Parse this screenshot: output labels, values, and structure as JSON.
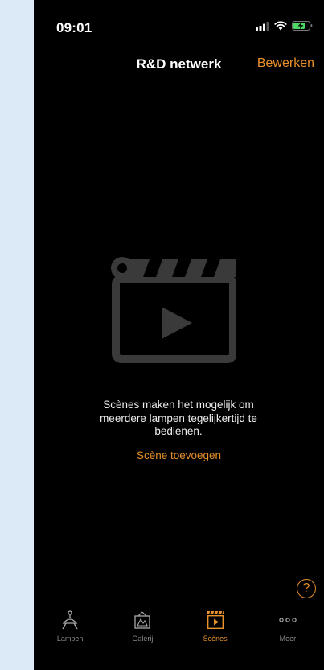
{
  "status_bar": {
    "time": "09:01"
  },
  "nav": {
    "title": "R&D netwerk",
    "edit_label": "Bewerken"
  },
  "empty_state": {
    "message": "Scènes maken het mogelijk om meerdere lampen tegelijkertijd te bedienen.",
    "add_label": "Scène toevoegen"
  },
  "help": {
    "label": "?"
  },
  "tabs": [
    {
      "label": "Lampen",
      "icon": "lamp-icon",
      "active": false
    },
    {
      "label": "Galerij",
      "icon": "gallery-icon",
      "active": false
    },
    {
      "label": "Scènes",
      "icon": "clapperboard-icon",
      "active": true
    },
    {
      "label": "Meer",
      "icon": "more-icon",
      "active": false
    }
  ],
  "colors": {
    "accent": "#e8902c",
    "background": "#000000",
    "inactive": "#8a8a8a"
  }
}
